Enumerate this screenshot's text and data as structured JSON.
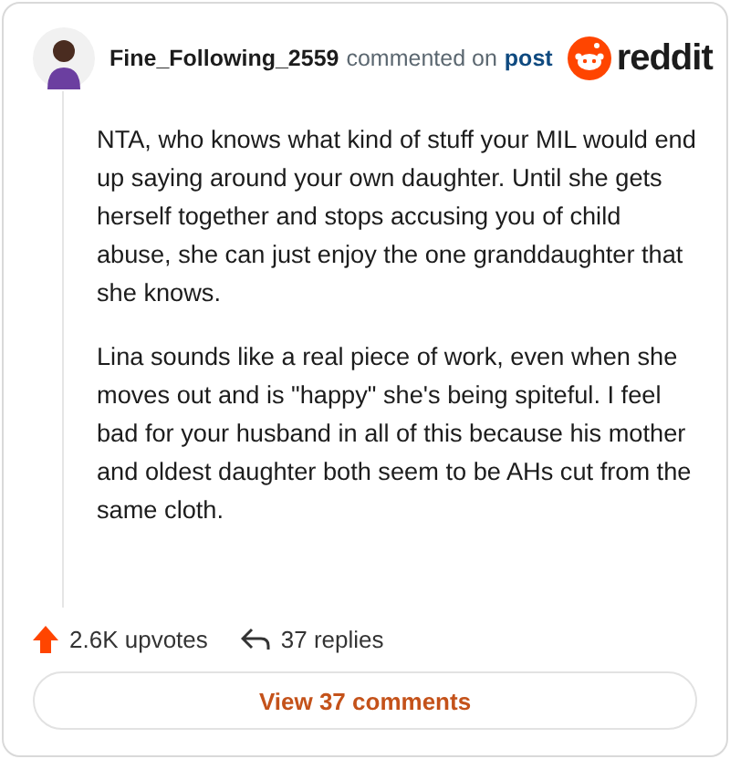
{
  "header": {
    "username": "Fine_Following_2559",
    "action": "commented on",
    "link": "post",
    "brand": "reddit"
  },
  "comment": {
    "paragraphs": [
      "NTA, who knows what kind of stuff your MIL would end up saying around your own daughter. Until she gets herself together and stops accusing you of child abuse, she can just enjoy the one granddaughter that she knows.",
      "Lina sounds like a real piece of work, even when she moves out and is \"happy\" she's being spiteful. I feel bad for your husband in all of this because his mother and oldest daughter both seem to be AHs cut from the same cloth."
    ]
  },
  "footer": {
    "upvotes": "2.6K upvotes",
    "replies": "37 replies"
  },
  "button": {
    "label": "View 37 comments"
  }
}
